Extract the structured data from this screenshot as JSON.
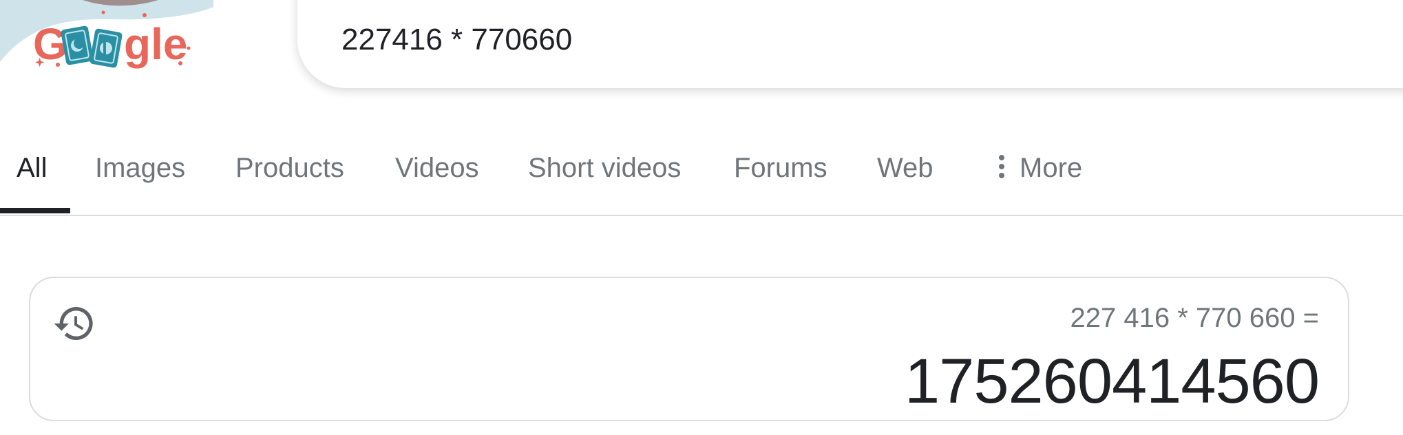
{
  "logo": {
    "text": "Google"
  },
  "search": {
    "query": "227416 * 770660"
  },
  "tabs": [
    {
      "label": "All",
      "active": true
    },
    {
      "label": "Images"
    },
    {
      "label": "Products"
    },
    {
      "label": "Videos"
    },
    {
      "label": "Short videos"
    },
    {
      "label": "Forums"
    },
    {
      "label": "Web"
    },
    {
      "label": "More",
      "icon": "more-vertical-icon"
    }
  ],
  "calculator": {
    "history_icon": "history-icon",
    "expression": "227 416 * 770 660 =",
    "result": "175260414560"
  },
  "colors": {
    "logo_red": "#e8675a",
    "logo_teal": "#2a8fa3",
    "doodle_bg": "#cfe4ea",
    "tab_active": "#202124",
    "tab_inactive": "#70757a",
    "border": "#dadce0"
  }
}
